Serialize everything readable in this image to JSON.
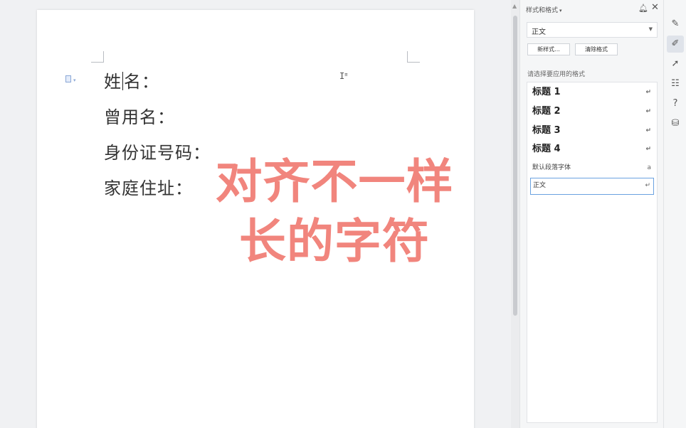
{
  "document": {
    "lines": [
      {
        "before": "姓",
        "after": "名："
      },
      {
        "text": "曾用名："
      },
      {
        "text": "身份证号码："
      },
      {
        "text": "家庭住址："
      }
    ],
    "ibeam_glyph": "I"
  },
  "overlay": {
    "line1": "对齐不一样",
    "line2": "长的字符",
    "color": "#f07c74"
  },
  "styles_panel": {
    "title": "样式和格式",
    "current_style": "正文",
    "new_style_button": "新样式...",
    "clear_format_button": "清除格式",
    "list_label": "请选择要应用的格式",
    "items": [
      {
        "label": "标题 1",
        "kind": "heading"
      },
      {
        "label": "标题 2",
        "kind": "heading"
      },
      {
        "label": "标题 3",
        "kind": "heading"
      },
      {
        "label": "标题 4",
        "kind": "heading"
      },
      {
        "label": "默认段落字体",
        "kind": "small",
        "mark": "a"
      },
      {
        "label": "正文",
        "kind": "selected"
      }
    ]
  },
  "right_toolbar": {
    "tools": [
      {
        "icon": "style-brush-icon"
      },
      {
        "icon": "pen-icon",
        "active": true
      },
      {
        "icon": "cursor-select-icon"
      },
      {
        "icon": "sliders-icon"
      },
      {
        "icon": "help-circle-icon"
      },
      {
        "icon": "backup-icon"
      }
    ]
  },
  "colors": {
    "accent": "#6aa2e0",
    "overlay_text": "#f07c74"
  }
}
